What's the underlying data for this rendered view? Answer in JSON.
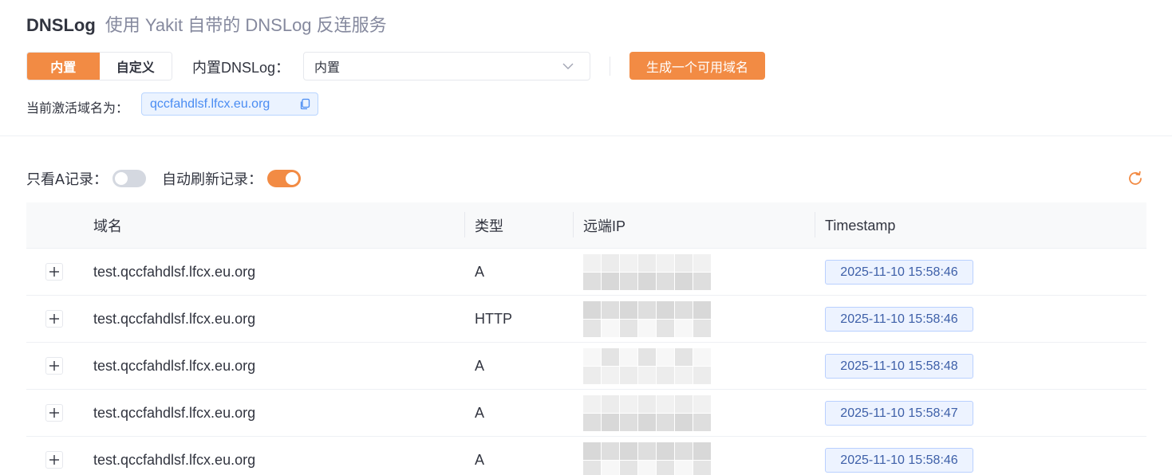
{
  "header": {
    "title": "DNSLog",
    "subtitle": "使用 Yakit 自带的 DNSLog 反连服务"
  },
  "mode_tabs": [
    {
      "label": "内置",
      "active": true
    },
    {
      "label": "自定义",
      "active": false
    }
  ],
  "dnslog_select": {
    "label": "内置DNSLog：",
    "value": "内置",
    "icon": "chevron-down-icon"
  },
  "generate_button": {
    "label": "生成一个可用域名"
  },
  "active_domain": {
    "label": "当前激活域名为：",
    "value": "qccfahdlsf.lfcx.eu.org",
    "icon": "copy-icon"
  },
  "filters": {
    "only_a": {
      "label": "只看A记录：",
      "on": false
    },
    "auto_refresh": {
      "label": "自动刷新记录：",
      "on": true
    },
    "refresh_icon": "refresh-icon"
  },
  "table": {
    "columns": [
      "域名",
      "类型",
      "远端IP",
      "Timestamp"
    ],
    "rows": [
      {
        "domain": "test.qccfahdlsf.lfcx.eu.org",
        "type": "A",
        "timestamp": "2025-11-10 15:58:46"
      },
      {
        "domain": "test.qccfahdlsf.lfcx.eu.org",
        "type": "HTTP",
        "timestamp": "2025-11-10 15:58:46"
      },
      {
        "domain": "test.qccfahdlsf.lfcx.eu.org",
        "type": "A",
        "timestamp": "2025-11-10 15:58:48"
      },
      {
        "domain": "test.qccfahdlsf.lfcx.eu.org",
        "type": "A",
        "timestamp": "2025-11-10 15:58:47"
      },
      {
        "domain": "test.qccfahdlsf.lfcx.eu.org",
        "type": "A",
        "timestamp": "2025-11-10 15:58:46"
      }
    ]
  },
  "colors": {
    "accent": "#f28b44",
    "tag_blue": "#4a8cf2",
    "switch_off": "#d4d8e0"
  }
}
